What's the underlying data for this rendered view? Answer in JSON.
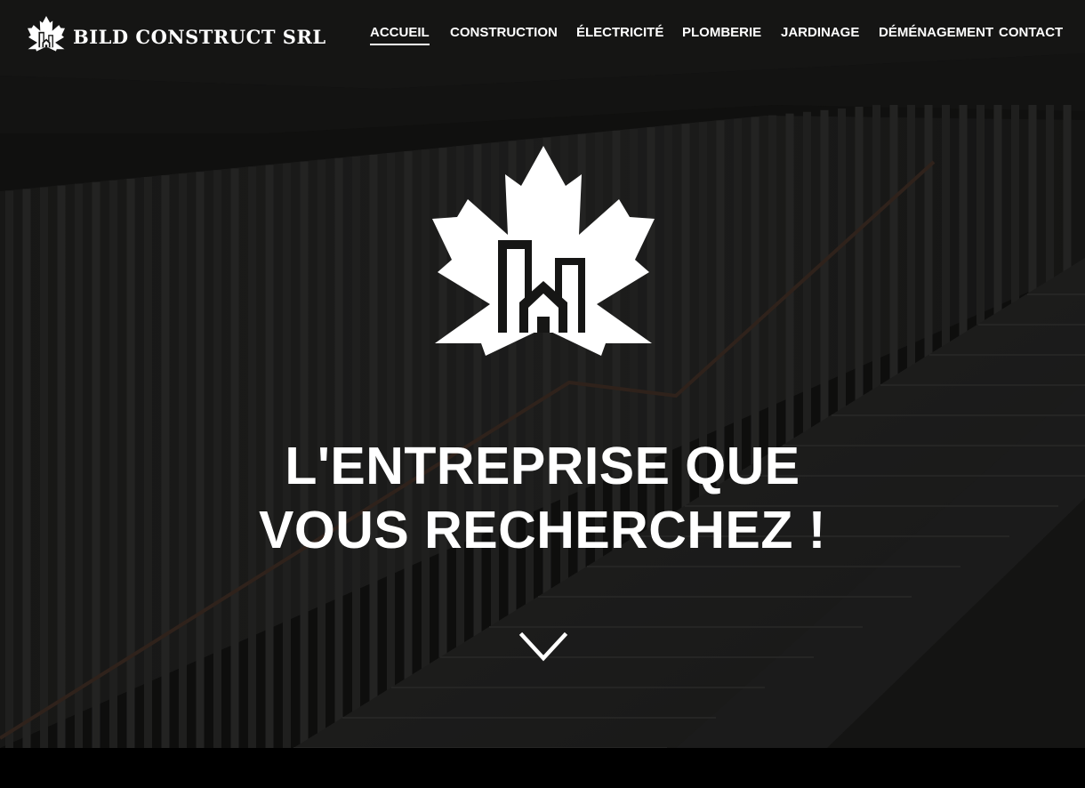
{
  "header": {
    "brand_name": "BILD CONSTRUCT SRL",
    "logo_icon": "maple-leaf-buildings-icon"
  },
  "nav": {
    "items": [
      {
        "label": "ACCUEIL",
        "active": true
      },
      {
        "label": "CONSTRUCTION",
        "active": false
      },
      {
        "label": "ÉLECTRICITÉ",
        "active": false
      },
      {
        "label": "PLOMBERIE",
        "active": false
      },
      {
        "label": "JARDINAGE",
        "active": false
      },
      {
        "label": "DÉMÉNAGEMENT",
        "active": false
      },
      {
        "label": "CONTACT",
        "active": false
      }
    ]
  },
  "hero": {
    "logo_icon": "maple-leaf-buildings-icon",
    "headline_line1": "L'ENTREPRISE QUE",
    "headline_line2": "VOUS RECHERCHEZ !",
    "scroll_icon": "chevron-down-icon"
  },
  "colors": {
    "text": "#ffffff",
    "background": "#161615",
    "footer_strip": "#000000"
  }
}
